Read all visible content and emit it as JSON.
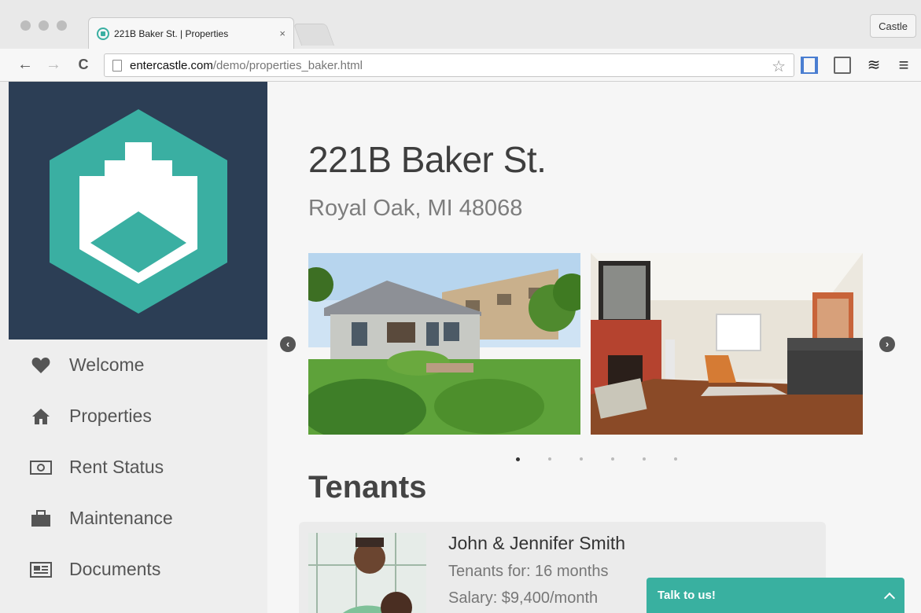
{
  "browser": {
    "tab_title": "221B Baker St. | Properties",
    "tab_close": "×",
    "profile_label": "Castle",
    "url_host": "entercastle.com",
    "url_path": "/demo/properties_baker.html",
    "back_glyph": "←",
    "forward_glyph": "→",
    "reload_glyph": "C",
    "star_glyph": "☆",
    "menu_glyph": "≡",
    "layers_glyph": "≋"
  },
  "sidebar": {
    "brand_color": "#2c3e55",
    "accent_color": "#3aafa2",
    "items": [
      {
        "label": "Welcome",
        "icon": "heart-icon"
      },
      {
        "label": "Properties",
        "icon": "home-icon"
      },
      {
        "label": "Rent Status",
        "icon": "money-icon"
      },
      {
        "label": "Maintenance",
        "icon": "briefcase-icon"
      },
      {
        "label": "Documents",
        "icon": "document-icon"
      }
    ]
  },
  "property": {
    "address": "221B Baker St.",
    "city_line": "Royal Oak, MI 48068",
    "carousel": {
      "prev_glyph": "‹",
      "next_glyph": "›",
      "slide_count": 6,
      "active_slide": 1
    }
  },
  "tenants": {
    "title": "Tenants",
    "list": [
      {
        "name": "John & Jennifer Smith",
        "duration": "Tenants for: 16 months",
        "salary": "Salary: $9,400/month"
      }
    ]
  },
  "chat": {
    "label": "Talk to us!"
  }
}
